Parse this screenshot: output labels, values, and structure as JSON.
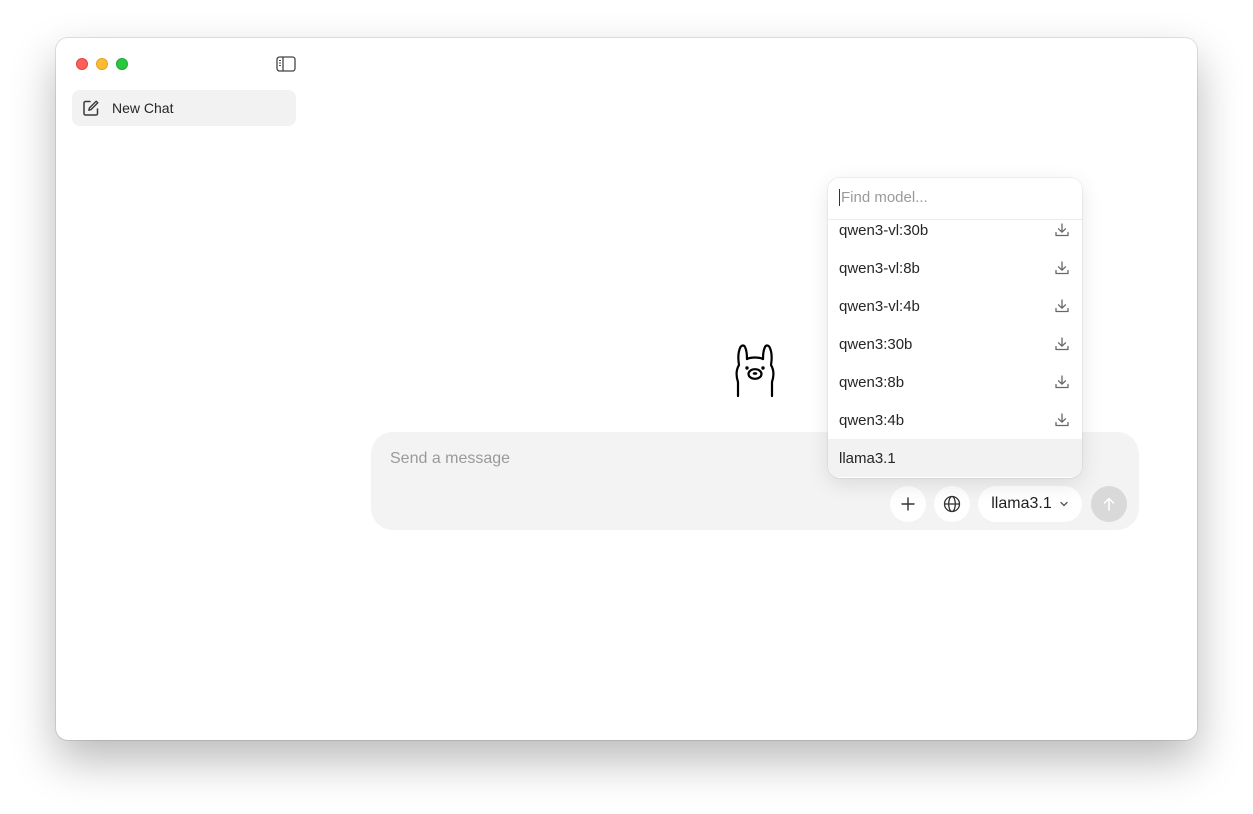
{
  "window": {
    "traffic_lights": [
      "close",
      "minimize",
      "zoom"
    ]
  },
  "sidebar": {
    "toggle_icon": "sidebar-toggle-icon",
    "new_chat_label": "New Chat",
    "new_chat_icon": "compose-icon"
  },
  "main": {
    "logo_icon": "llama-icon"
  },
  "composer": {
    "placeholder": "Send a message",
    "value": "",
    "attach_icon": "plus-icon",
    "web_search_icon": "globe-icon",
    "model_selected": "llama3.1",
    "model_chevron_icon": "chevron-down-icon",
    "send_icon": "arrow-up-icon"
  },
  "model_dropdown": {
    "search_placeholder": "Find model...",
    "search_value": "",
    "items": [
      {
        "name": "qwen3-vl:30b",
        "downloadable": true
      },
      {
        "name": "qwen3-vl:8b",
        "downloadable": true
      },
      {
        "name": "qwen3-vl:4b",
        "downloadable": true
      },
      {
        "name": "qwen3:30b",
        "downloadable": true
      },
      {
        "name": "qwen3:8b",
        "downloadable": true
      },
      {
        "name": "qwen3:4b",
        "downloadable": true
      },
      {
        "name": "llama3.1",
        "downloadable": false,
        "selected": true
      }
    ]
  },
  "colors": {
    "close": "#ff5f57",
    "minimize": "#febc2e",
    "zoom": "#28c840",
    "composer_bg": "#f3f3f3",
    "send_disabled": "#d9d9d9"
  }
}
